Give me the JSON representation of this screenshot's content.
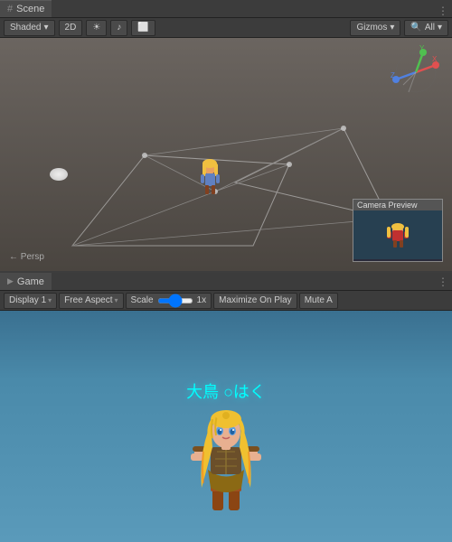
{
  "scene": {
    "tab_label": "Scene",
    "toolbar": {
      "shaded": "Shaded",
      "shaded_arrow": "▾",
      "toggle_2d": "2D",
      "gizmos": "Gizmos",
      "gizmos_arrow": "▾",
      "all_label": "All",
      "all_arrow": "▾",
      "persp_label": "← Persp"
    },
    "camera_preview": {
      "title": "Camera Preview"
    }
  },
  "game": {
    "tab_label": "Game",
    "toolbar": {
      "display_label": "Display 1",
      "display_arrow": "▾",
      "aspect_label": "Free Aspect",
      "aspect_arrow": "▾",
      "scale_label": "Scale",
      "scale_value": "1x",
      "maximize_label": "Maximize On Play",
      "mute_label": "Mute A"
    },
    "character_name": "大鳥 ○はく"
  },
  "icons": {
    "scene_hash": "#",
    "game_triangle": "▶",
    "sun": "☀",
    "settings": "⚙",
    "ellipsis": "⋮",
    "layers": "≡"
  }
}
